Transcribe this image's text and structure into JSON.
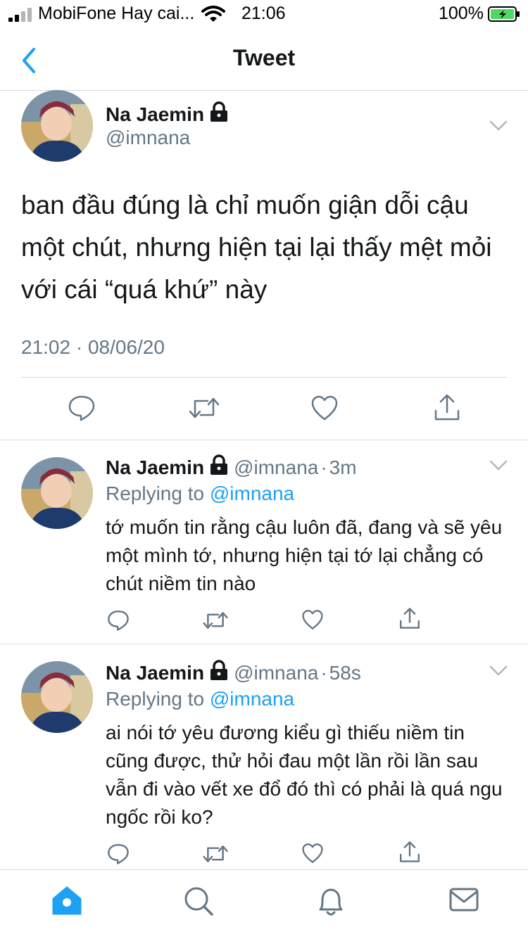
{
  "status_bar": {
    "carrier": "MobiFone Hay cai...",
    "time": "21:06",
    "battery": "100%"
  },
  "nav": {
    "title": "Tweet"
  },
  "main_tweet": {
    "name": "Na Jaemin",
    "handle": "@imnana",
    "text": "ban đầu đúng là chỉ muốn giận dỗi cậu một chút, nhưng hiện tại lại thấy mệt mỏi với cái “quá khứ” này",
    "timestamp": "21:02 · 08/06/20"
  },
  "replies": [
    {
      "name": "Na Jaemin",
      "handle": "@imnana",
      "separator": "·",
      "time": "3m",
      "replying_label": "Replying to",
      "replying_to": "@imnana",
      "text": "tớ muốn tin rằng cậu luôn đã, đang và sẽ yêu một mình tớ, nhưng hiện tại tớ lại chẳng có chút niềm tin nào"
    },
    {
      "name": "Na Jaemin",
      "handle": "@imnana",
      "separator": "·",
      "time": "58s",
      "replying_label": "Replying to",
      "replying_to": "@imnana",
      "text": "ai nói tớ yêu đương kiểu gì thiếu niềm tin cũng được, thử hỏi đau một lần rồi lần sau vẫn đi vào vết xe đổ đó thì có phải là quá ngu ngốc rồi ko?"
    }
  ],
  "icons": [
    "back-chevron-icon",
    "lock-icon",
    "chevron-down-icon",
    "reply-icon",
    "retweet-icon",
    "like-icon",
    "share-icon",
    "home-icon",
    "search-icon",
    "notifications-icon",
    "messages-icon"
  ],
  "colors": {
    "accent": "#1da1f2",
    "text": "#14171a",
    "secondary": "#657786",
    "divider": "#d6dbe0",
    "battery": "#4cd964"
  }
}
